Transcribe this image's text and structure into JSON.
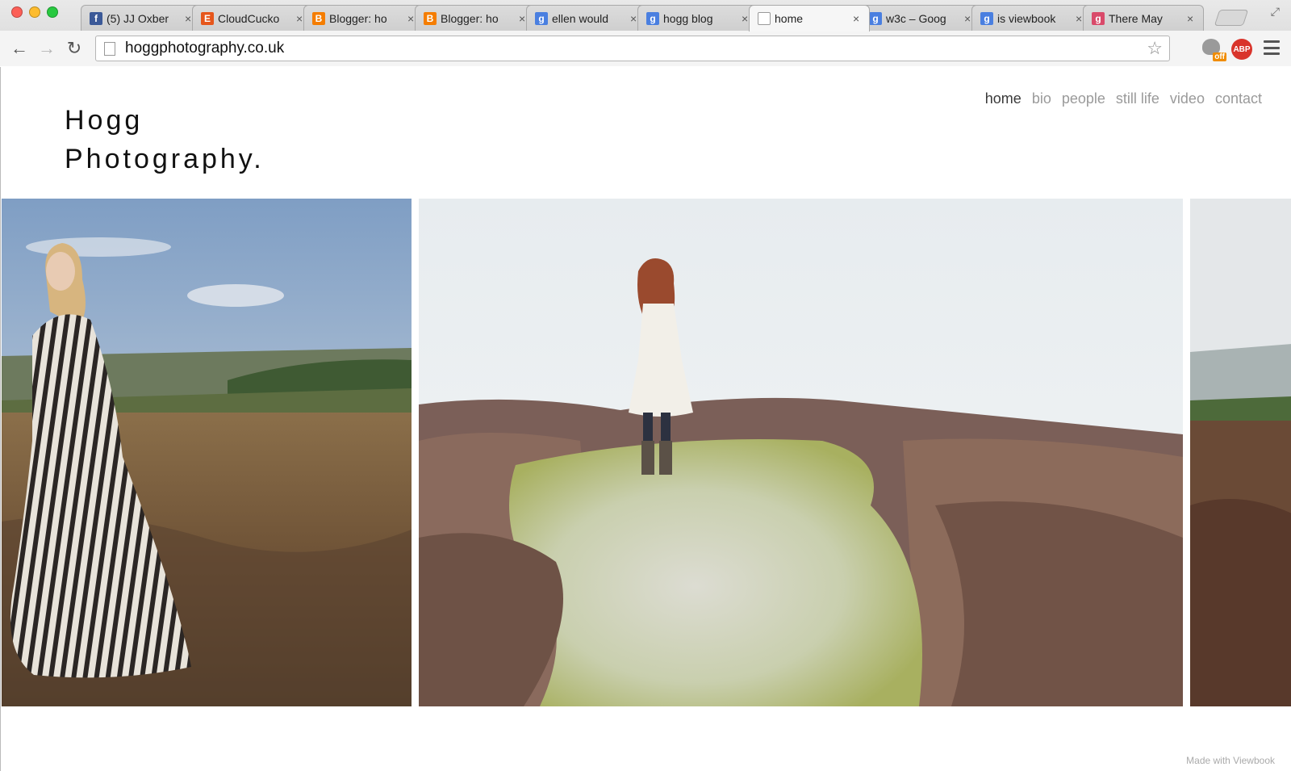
{
  "browser": {
    "tabs": [
      {
        "label": "(5) JJ Oxber",
        "icon": "facebook-icon",
        "fav_text": "f",
        "fav_color": "#3b5998"
      },
      {
        "label": "CloudCucko",
        "icon": "etsy-icon",
        "fav_text": "E",
        "fav_color": "#e6561b"
      },
      {
        "label": "Blogger: ho",
        "icon": "blogger-icon",
        "fav_text": "B",
        "fav_color": "#f57d00"
      },
      {
        "label": "Blogger: ho",
        "icon": "blogger-icon",
        "fav_text": "B",
        "fav_color": "#f57d00"
      },
      {
        "label": "ellen would",
        "icon": "google-icon",
        "fav_text": "g",
        "fav_color": "#4a7fe0"
      },
      {
        "label": "hogg blog",
        "icon": "google-icon",
        "fav_text": "g",
        "fav_color": "#4a7fe0"
      },
      {
        "label": "home",
        "icon": "page-icon",
        "fav_text": "",
        "fav_color": "#ffffff",
        "active": true
      },
      {
        "label": "w3c – Goog",
        "icon": "google-icon",
        "fav_text": "g",
        "fav_color": "#4a7fe0"
      },
      {
        "label": "is viewbook",
        "icon": "google-icon",
        "fav_text": "g",
        "fav_color": "#4a7fe0"
      },
      {
        "label": "There May",
        "icon": "script-g-icon",
        "fav_text": "g",
        "fav_color": "#d94a6a"
      }
    ],
    "url": "hoggphotography.co.uk",
    "extensions": {
      "cat_badge": "off",
      "abp": "ABP"
    }
  },
  "site": {
    "logo_line1": "Hogg",
    "logo_line2": "Photography.",
    "nav": [
      {
        "label": "home",
        "current": true
      },
      {
        "label": "bio"
      },
      {
        "label": "people"
      },
      {
        "label": "still life"
      },
      {
        "label": "video"
      },
      {
        "label": "contact"
      }
    ],
    "footer_credit": "Made with Viewbook"
  },
  "colors": {
    "nav_active": "#3a3a3a",
    "nav_inactive": "#9a9a9a"
  }
}
